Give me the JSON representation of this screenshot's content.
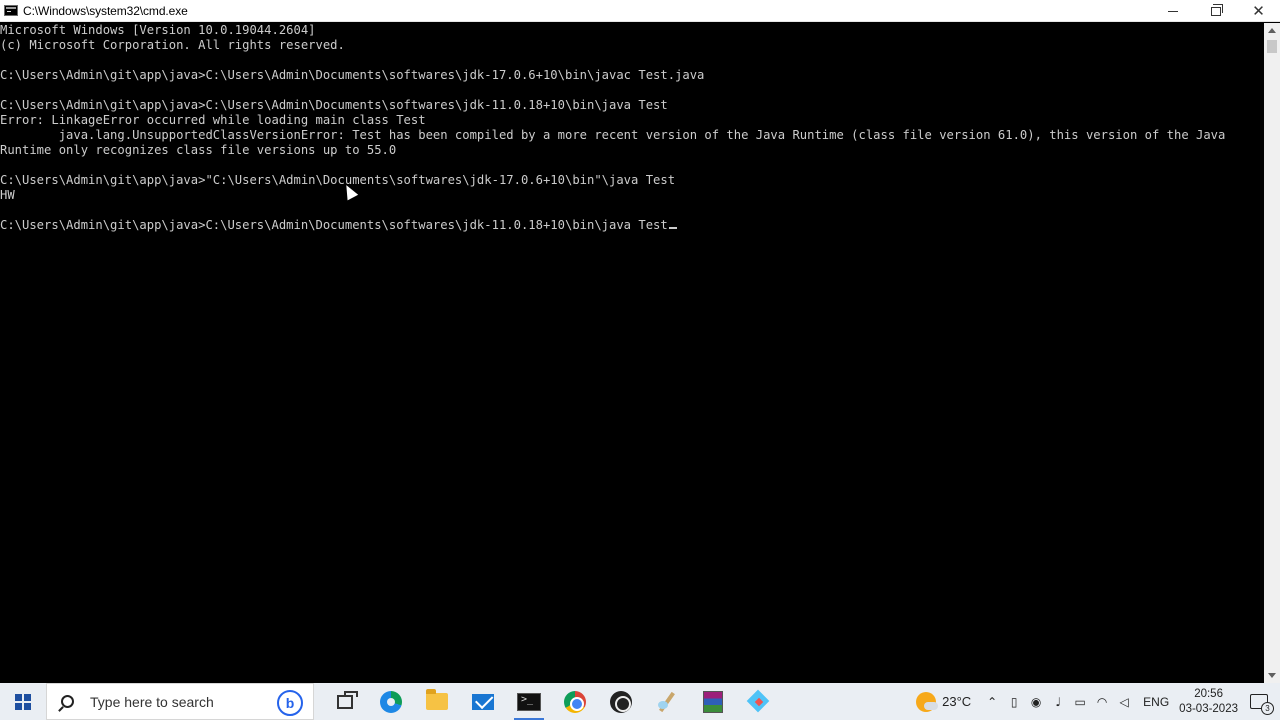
{
  "window": {
    "title": "C:\\Windows\\system32\\cmd.exe",
    "controls": {
      "minimize": "—",
      "maximize": "",
      "close": "✕"
    }
  },
  "console": {
    "lines": [
      "Microsoft Windows [Version 10.0.19044.2604]",
      "(c) Microsoft Corporation. All rights reserved.",
      "",
      "C:\\Users\\Admin\\git\\app\\java>C:\\Users\\Admin\\Documents\\softwares\\jdk-17.0.6+10\\bin\\javac Test.java",
      "",
      "C:\\Users\\Admin\\git\\app\\java>C:\\Users\\Admin\\Documents\\softwares\\jdk-11.0.18+10\\bin\\java Test",
      "Error: LinkageError occurred while loading main class Test",
      "        java.lang.UnsupportedClassVersionError: Test has been compiled by a more recent version of the Java Runtime (class file version 61.0), this version of the Java",
      "Runtime only recognizes class file versions up to 55.0",
      "",
      "C:\\Users\\Admin\\git\\app\\java>\"C:\\Users\\Admin\\Documents\\softwares\\jdk-17.0.6+10\\bin\"\\java Test",
      "HW",
      "",
      "C:\\Users\\Admin\\git\\app\\java>C:\\Users\\Admin\\Documents\\softwares\\jdk-11.0.18+10\\bin\\java Test"
    ]
  },
  "taskbar": {
    "search_placeholder": "Type here to search",
    "bing_label": "b",
    "apps": [
      {
        "name": "task-view",
        "icon": "task-view-icon"
      },
      {
        "name": "edge",
        "icon": "edge-icon"
      },
      {
        "name": "file-explorer",
        "icon": "folder-icon"
      },
      {
        "name": "mail",
        "icon": "mail-icon"
      },
      {
        "name": "command-prompt",
        "icon": "cmd-icon",
        "active": true
      },
      {
        "name": "chrome",
        "icon": "chrome-icon"
      },
      {
        "name": "obs",
        "icon": "obs-icon"
      },
      {
        "name": "paint",
        "icon": "paint-icon"
      },
      {
        "name": "winrar",
        "icon": "winrar-icon"
      },
      {
        "name": "app",
        "icon": "app-icon"
      }
    ],
    "tray": {
      "temperature": "23°C",
      "language": "ENG",
      "time": "20:56",
      "date": "03-03-2023",
      "notification_count": "3"
    }
  }
}
